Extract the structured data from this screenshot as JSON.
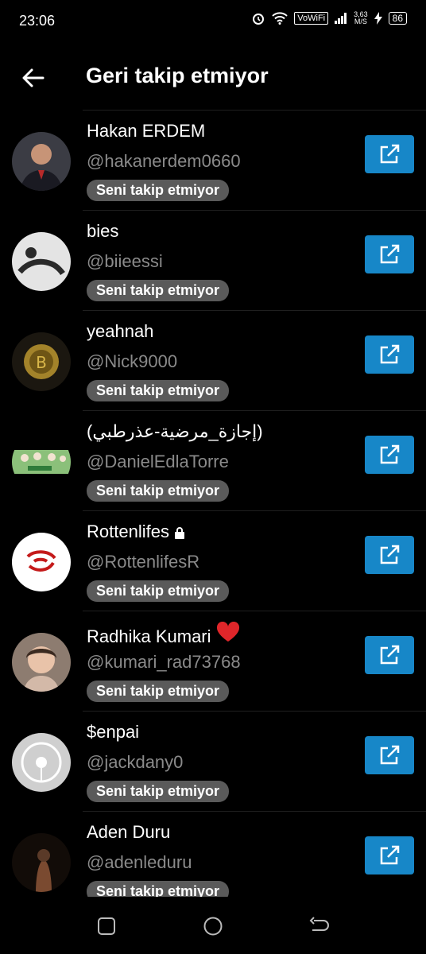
{
  "status_bar": {
    "time": "23:06",
    "vowifi": "VoWiFi",
    "speed_value": "3,63",
    "speed_unit": "M/S",
    "battery": "86"
  },
  "header": {
    "title": "Geri takip etmiyor"
  },
  "badge_label": "Seni takip etmiyor",
  "users": [
    {
      "name": "Hakan ERDEM",
      "handle": "@hakanerdem0660",
      "avatar_color": "#6b4a3a"
    },
    {
      "name": "bies",
      "handle": "@biieessi",
      "avatar_color": "#d9d9d9"
    },
    {
      "name": "yeahnah",
      "handle": "@Nick9000",
      "avatar_color": "#8a6a20"
    },
    {
      "name": "(إجازة_مرضية-عذرطبي)",
      "handle": "@DanielEdlaTorre",
      "avatar_color": "#7fb06a"
    },
    {
      "name": "Rottenlifes",
      "handle": "@RottenlifesR",
      "avatar_color": "#ffffff"
    },
    {
      "name": "Radhika Kumari",
      "handle": "@kumari_rad73768",
      "avatar_color": "#c9a994"
    },
    {
      "name": "$enpai",
      "handle": "@jackdany0",
      "avatar_color": "#cfcfcf"
    },
    {
      "name": "Aden Duru",
      "handle": "@adenleduru",
      "avatar_color": "#2a1a14"
    }
  ],
  "colors": {
    "accent": "#1787c8",
    "badge_bg": "#5a5a5a",
    "handle": "#8a8a8a"
  },
  "icons": {
    "back": "arrow-left-icon",
    "open": "external-link-icon",
    "lock": "lock-icon",
    "heart": "heart-icon"
  }
}
